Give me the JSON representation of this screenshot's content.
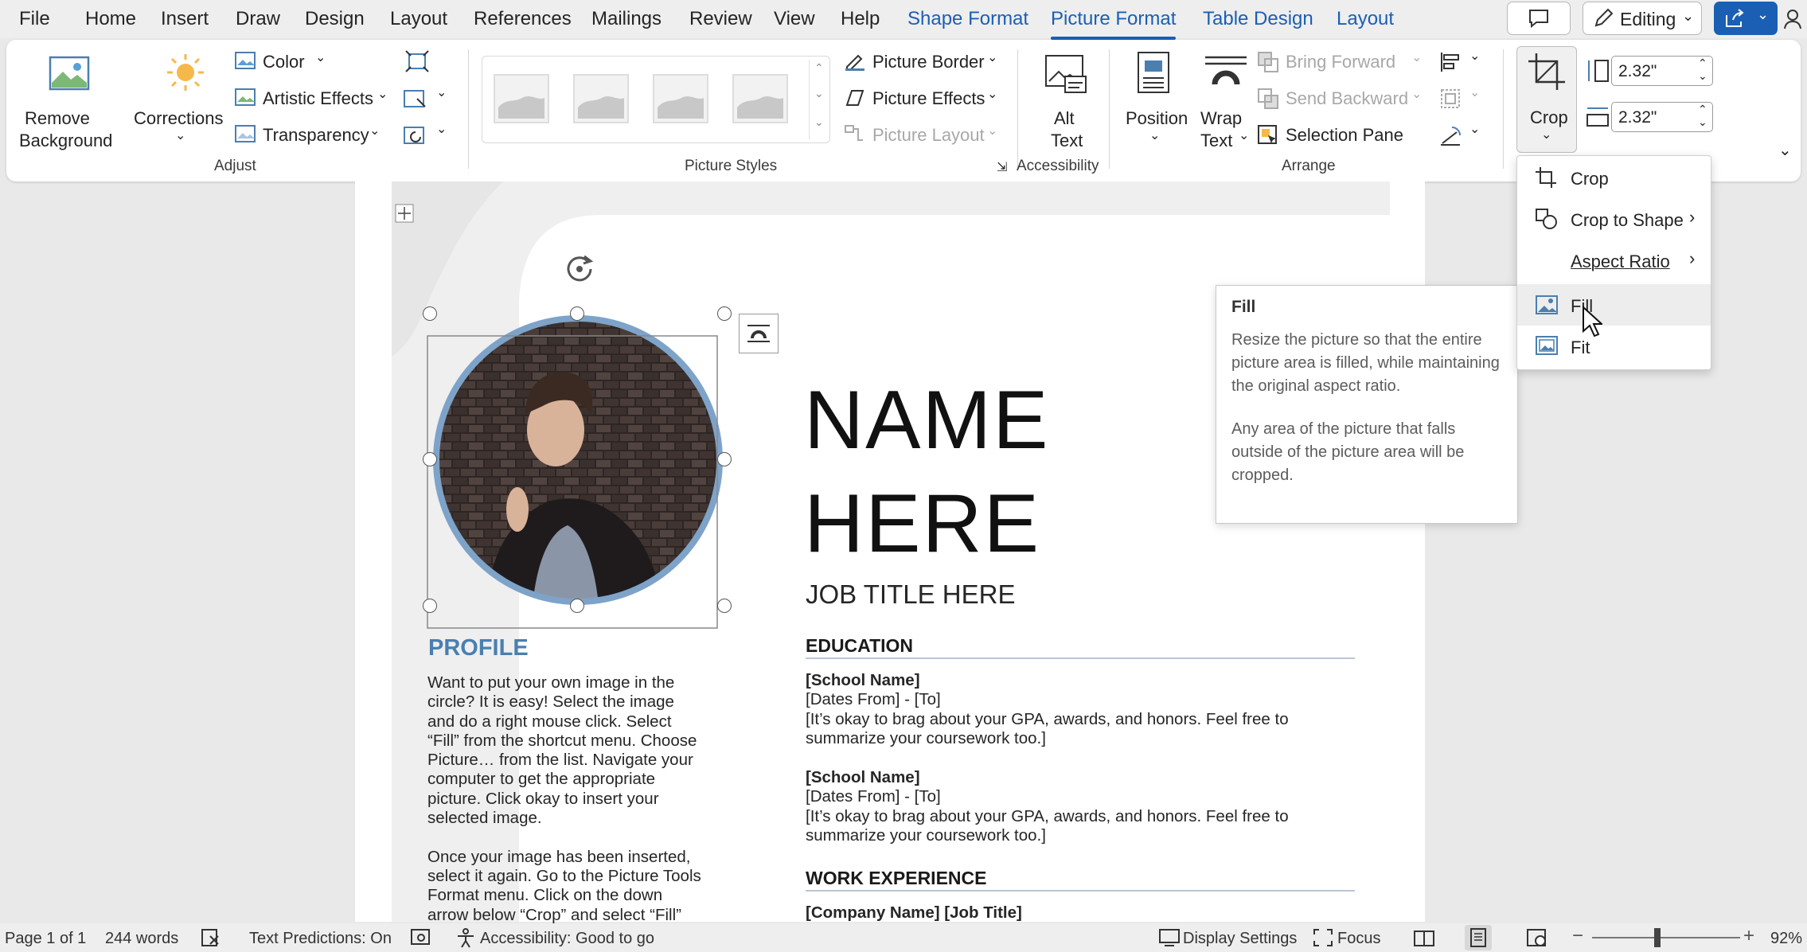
{
  "tabs": [
    "File",
    "Home",
    "Insert",
    "Draw",
    "Design",
    "Layout",
    "References",
    "Mailings",
    "Review",
    "View",
    "Help"
  ],
  "context_tabs": [
    "Shape Format",
    "Picture Format",
    "Table Design",
    "Layout"
  ],
  "active_tab": "Picture Format",
  "editing_label": "Editing",
  "ribbon": {
    "remove_background": [
      "Remove",
      "Background"
    ],
    "corrections": "Corrections",
    "color": "Color",
    "artistic_effects": "Artistic Effects",
    "transparency": "Transparency",
    "adjust_group": "Adjust",
    "picture_border": "Picture Border",
    "picture_effects": "Picture Effects",
    "picture_layout": "Picture Layout",
    "picture_styles_group": "Picture Styles",
    "alt_text": [
      "Alt",
      "Text"
    ],
    "accessibility_group": "Accessibility",
    "position": "Position",
    "wrap_text": [
      "Wrap",
      "Text"
    ],
    "bring_forward": "Bring Forward",
    "send_backward": "Send Backward",
    "selection_pane": "Selection Pane",
    "arrange_group": "Arrange",
    "crop": "Crop",
    "height_value": "2.32\"",
    "width_value": "2.32\""
  },
  "crop_menu": {
    "items": [
      "Crop",
      "Crop to Shape",
      "Aspect Ratio",
      "Fill",
      "Fit"
    ],
    "hovered": "Fill"
  },
  "tooltip": {
    "title": "Fill",
    "para1": "Resize the picture so that the entire picture area is filled, while maintaining the original aspect ratio.",
    "para2": "Any area of the picture that falls outside of the picture area will be cropped."
  },
  "document": {
    "name_line1": "NAME",
    "name_line2": "HERE",
    "job_title": "JOB TITLE HERE",
    "profile_heading": "PROFILE",
    "profile_lines": [
      "Want to put your own image in the",
      "circle?  It is easy!  Select the image",
      "and do a right mouse click.  Select",
      "“Fill” from the shortcut menu.  Choose",
      "Picture… from the list.  Navigate your",
      "computer to get the appropriate",
      "picture.  Click okay to insert your",
      "selected image.",
      "",
      "Once your image has been inserted,",
      "select it again.  Go to the Picture Tools",
      "Format menu. Click on the down",
      "arrow below “Crop” and select “Fill”"
    ],
    "education_heading": "EDUCATION",
    "school1": [
      "[School Name]",
      "[Dates From] - [To]",
      "[It’s okay to brag about your GPA, awards, and honors. Feel free to",
      "summarize your coursework too.]"
    ],
    "school2": [
      "[School Name]",
      "[Dates From] - [To]",
      "[It’s okay to brag about your GPA, awards, and honors. Feel free to",
      "summarize your coursework too.]"
    ],
    "work_heading": "WORK EXPERIENCE",
    "work_line": "[Company Name]  [Job Title]"
  },
  "status": {
    "page": "Page 1 of 1",
    "words": "244 words",
    "text_predictions": "Text Predictions: On",
    "accessibility": "Accessibility: Good to go",
    "display_settings": "Display Settings",
    "focus": "Focus",
    "zoom": "92%"
  },
  "colors": {
    "accent": "#1a5fb4",
    "profile": "#4a7fb0",
    "ring": "#7ea3c9"
  }
}
